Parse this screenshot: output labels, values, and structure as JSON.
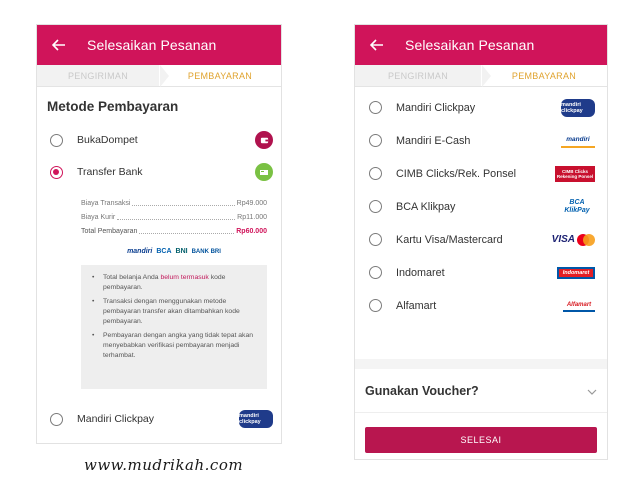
{
  "left": {
    "header": {
      "title": "Selesaikan Pesanan"
    },
    "steps": [
      "PENGIRIMAN",
      "PEMBAYARAN"
    ],
    "section_title": "Metode Pembayaran",
    "options": [
      {
        "label": "BukaDompet",
        "checked": false
      },
      {
        "label": "Transfer Bank",
        "checked": true
      }
    ],
    "fees": [
      {
        "label": "Biaya Transaksi",
        "value": "Rp49.000"
      },
      {
        "label": "Biaya Kurir",
        "value": "Rp11.000"
      },
      {
        "label": "Total Pembayaran",
        "value": "Rp60.000"
      }
    ],
    "banks": [
      "mandiri",
      "BCA",
      "BNI",
      "BANK BRI"
    ],
    "notes": {
      "n1_pre": "Total belanja Anda ",
      "n1_hl": "belum termasuk",
      "n1_post": " kode pembayaran.",
      "n2": "Transaksi dengan menggunakan metode pembayaran transfer akan ditambahkan kode pembayaran.",
      "n3": "Pembayaran dengan angka yang tidak tepat akan menyebabkan verifikasi pembayaran menjadi terhambat."
    },
    "bottom_option": {
      "label": "Mandiri Clickpay",
      "logo": "mandiri clickpay"
    }
  },
  "right": {
    "header": {
      "title": "Selesaikan Pesanan"
    },
    "steps": [
      "PENGIRIMAN",
      "PEMBAYARAN"
    ],
    "options": [
      {
        "label": "Mandiri Clickpay",
        "logo": "mandiri clickpay"
      },
      {
        "label": "Mandiri E-Cash",
        "logo": "mandiri"
      },
      {
        "label": "CIMB Clicks/Rek. Ponsel",
        "logo": "CIMB Clicks Rekening Ponsel"
      },
      {
        "label": "BCA Klikpay",
        "logo": "BCA KlikPay"
      },
      {
        "label": "Kartu Visa/Mastercard",
        "logo": "VISA"
      },
      {
        "label": "Indomaret",
        "logo": "Indomaret"
      },
      {
        "label": "Alfamart",
        "logo": "Alfamart"
      }
    ],
    "voucher": "Gunakan Voucher?",
    "submit": "SELESAI"
  },
  "watermark": "www.mudrikah.com",
  "colors": {
    "primary": "#d0145a",
    "step_active": "#e0a32e",
    "button": "#b8164f"
  }
}
